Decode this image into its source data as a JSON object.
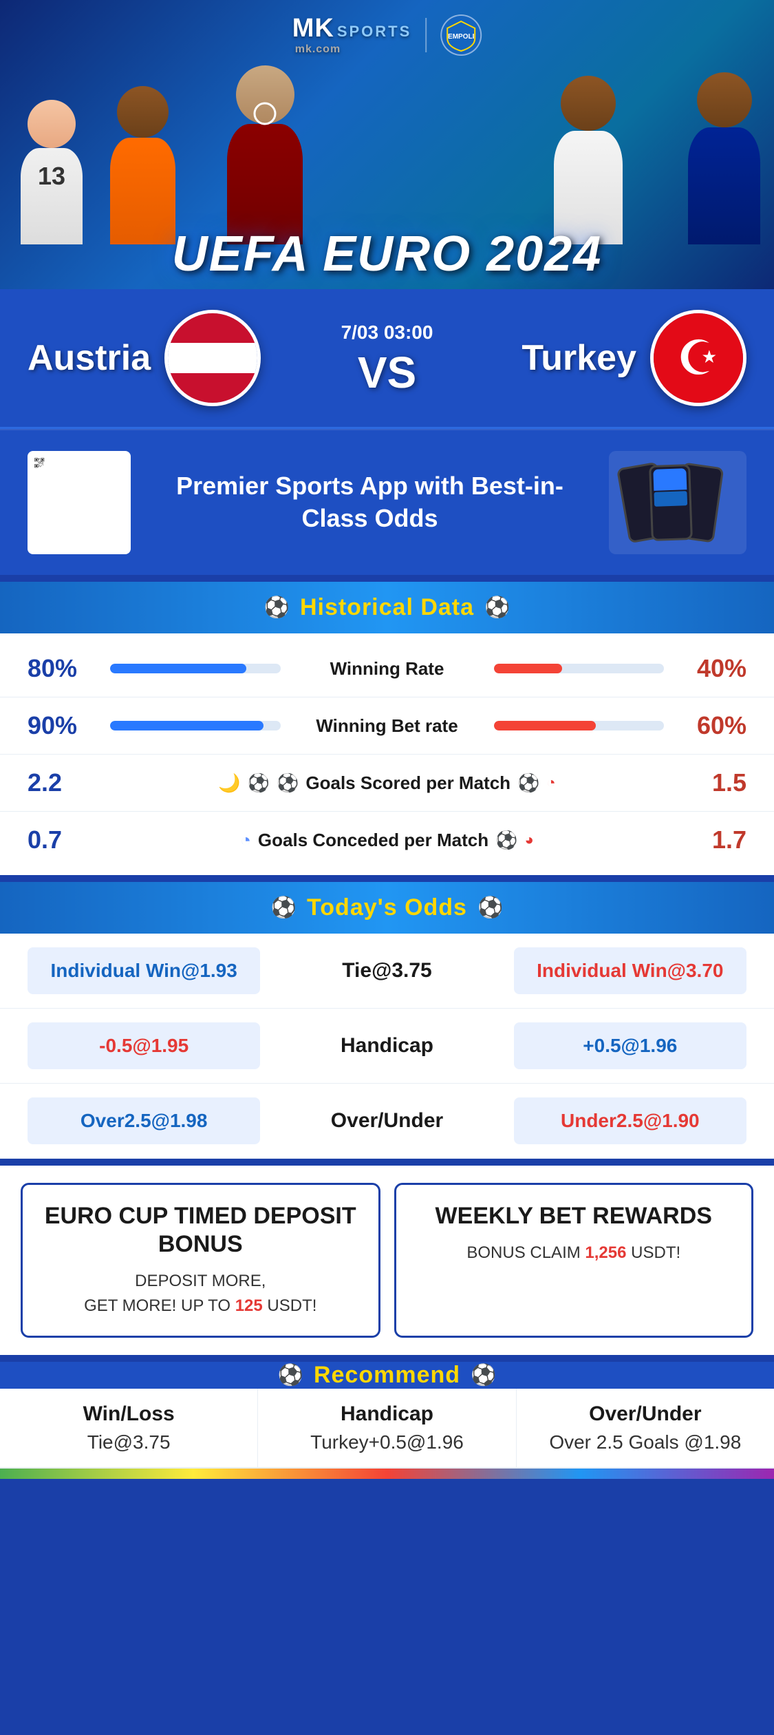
{
  "brand": {
    "mk": "MK",
    "sports": "SPORTS",
    "dotcom": "mk.com"
  },
  "event": {
    "title": "UEFA EURO 2024"
  },
  "match": {
    "home_team": "Austria",
    "away_team": "Turkey",
    "date_time": "7/03 03:00",
    "vs": "VS"
  },
  "app_promo": {
    "title": "Premier Sports App\nwith Best-in-Class Odds"
  },
  "historical": {
    "section_title": "Historical Data",
    "stats": [
      {
        "label": "Winning Rate",
        "left_val": "80%",
        "right_val": "40%",
        "left_pct": 80,
        "right_pct": 40
      },
      {
        "label": "Winning Bet rate",
        "left_val": "90%",
        "right_val": "60%",
        "left_pct": 90,
        "right_pct": 60
      },
      {
        "label": "Goals Scored per Match",
        "left_val": "2.2",
        "right_val": "1.5",
        "left_pct": null,
        "right_pct": null
      },
      {
        "label": "Goals Conceded per Match",
        "left_val": "0.7",
        "right_val": "1.7",
        "left_pct": null,
        "right_pct": null
      }
    ]
  },
  "odds": {
    "section_title": "Today's Odds",
    "rows": [
      {
        "left_btn": "Individual Win@1.93",
        "center_label": "Tie@3.75",
        "right_btn": "Individual Win@3.70",
        "left_color": "blue",
        "right_color": "red"
      },
      {
        "left_btn": "-0.5@1.95",
        "center_label": "Handicap",
        "right_btn": "+0.5@1.96",
        "left_color": "red",
        "right_color": "blue"
      },
      {
        "left_btn": "Over2.5@1.98",
        "center_label": "Over/Under",
        "right_btn": "Under2.5@1.90",
        "left_color": "blue",
        "right_color": "red"
      }
    ]
  },
  "bonus": {
    "card1_title": "EURO CUP TIMED DEPOSIT BONUS",
    "card1_desc_line1": "DEPOSIT MORE,",
    "card1_desc_line2": "GET MORE! UP TO",
    "card1_amount": "125",
    "card1_currency": "USDT!",
    "card2_title": "WEEKLY BET REWARDS",
    "card2_desc": "BONUS CLAIM",
    "card2_amount": "1,256",
    "card2_currency": "USDT!"
  },
  "recommend": {
    "section_title": "Recommend",
    "cols": [
      {
        "title": "Win/Loss",
        "value": "Tie@3.75"
      },
      {
        "title": "Handicap",
        "value": "Turkey+0.5@1.96"
      },
      {
        "title": "Over/Under",
        "value": "Over 2.5 Goals @1.98"
      }
    ]
  }
}
